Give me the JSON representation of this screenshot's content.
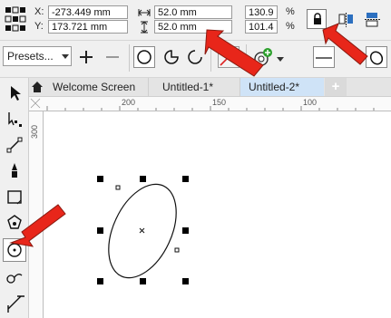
{
  "propbar": {
    "x_label": "X:",
    "y_label": "Y:",
    "x_value": "-273.449 mm",
    "y_value": "173.721 mm",
    "width_value": "52.0 mm",
    "height_value": "52.0 mm",
    "scale_x": "130.9",
    "scale_y": "101.4",
    "percent": "%"
  },
  "toolbar2": {
    "presets_label": "Presets..."
  },
  "tabs": [
    {
      "label": "Welcome Screen"
    },
    {
      "label": "Untitled-1*"
    },
    {
      "label": "Untitled-2*"
    }
  ],
  "add_tab_label": "+",
  "ruler": {
    "h_ticks": [
      "200",
      "150",
      "100"
    ],
    "v_ticks": [
      "300",
      "2"
    ]
  },
  "colors": {
    "arrow": "#e8261a",
    "active_tab": "#cfe3f7"
  },
  "icons": {
    "home": "home-icon",
    "lock": "lock-icon",
    "ellipse": "ellipse-icon"
  }
}
